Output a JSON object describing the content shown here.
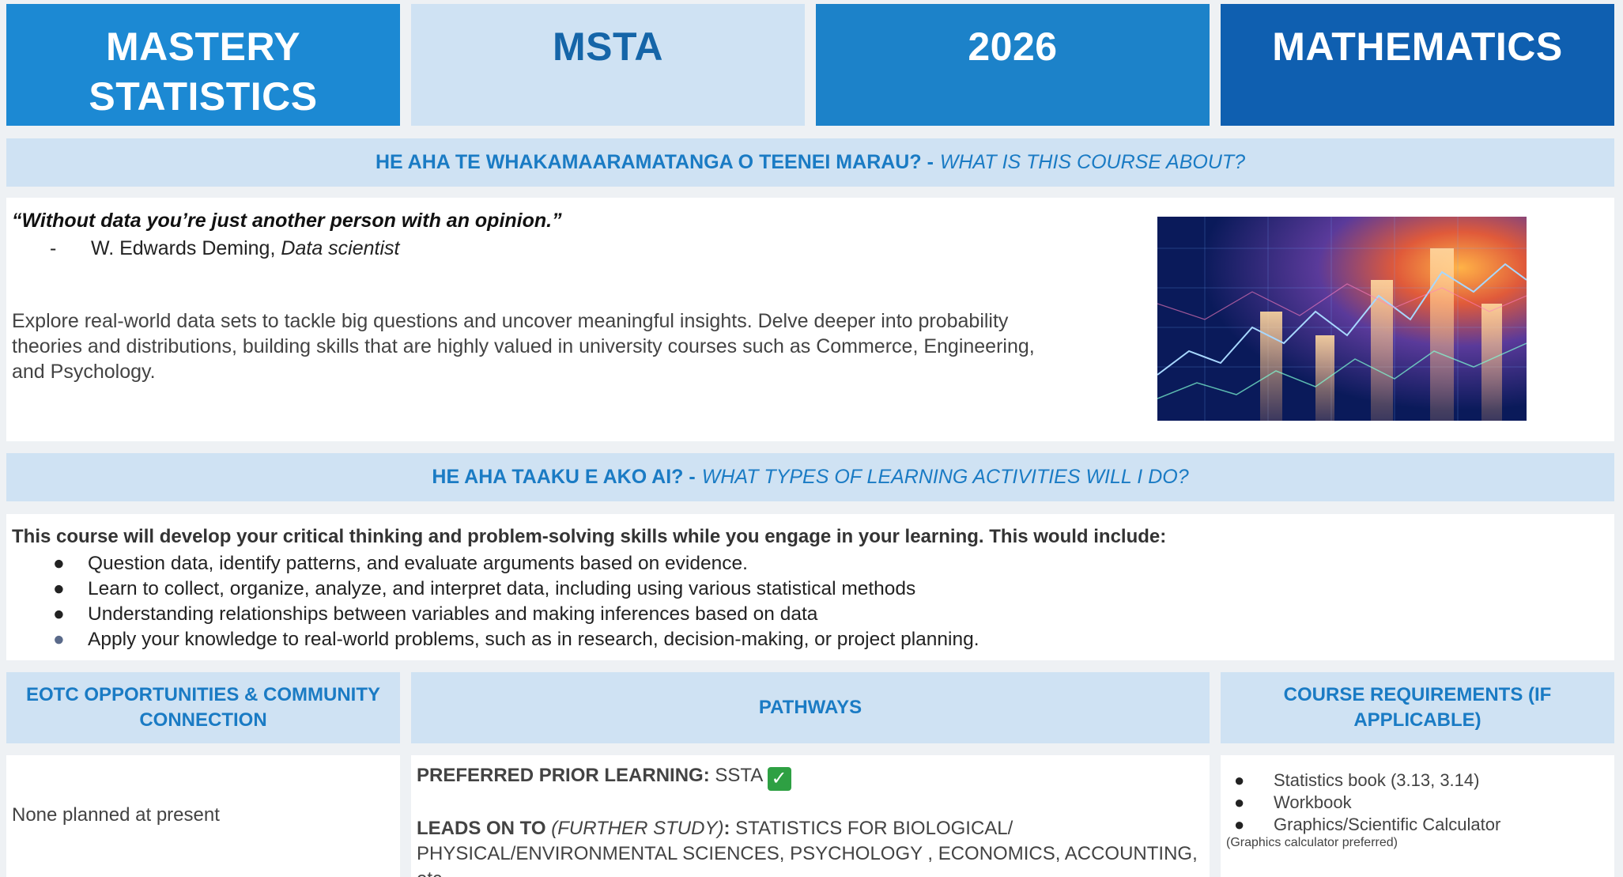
{
  "header": {
    "title": "MASTERY STATISTICS",
    "code": "MSTA",
    "year": "2026",
    "subject": "MATHEMATICS",
    "colors": {
      "title_bg": "#1c89d3",
      "code_bg": "#cfe2f3",
      "year_bg": "#1c82c9",
      "subject_bg": "#0f5fb0",
      "accent": "#1a7bc4"
    }
  },
  "about": {
    "heading_maori": "HE AHA TE WHAKAMAARAMATANGA O TEENEI MARAU? -",
    "heading_english": "WHAT IS THIS COURSE ABOUT?",
    "quote": "“Without data you’re just another person with an opinion.”",
    "attribution_dash": "-",
    "attribution_name": "W. Edwards Deming,",
    "attribution_role": "Data scientist",
    "description": "Explore real-world data sets to tackle big questions and uncover meaningful insights. Delve deeper into probability theories and distributions, building skills that are highly valued in university courses such as Commerce, Engineering, and Psychology.",
    "image_icon": "financial-chart-image"
  },
  "activities": {
    "heading_maori": "HE AHA TAAKU E AKO AI? -",
    "heading_english": "WHAT TYPES OF LEARNING ACTIVITIES WILL I DO?",
    "intro": "This course will develop your critical thinking and problem-solving skills while you engage in your learning. This would include:",
    "items": [
      "Question data, identify patterns, and evaluate arguments based on evidence.",
      "Learn to collect, organize, analyze, and interpret data, including using various statistical methods",
      "Understanding relationships between variables and making inferences based on data",
      "Apply your knowledge to real-world problems, such as in research, decision-making, or project planning."
    ]
  },
  "eotc": {
    "heading": "EOTC OPPORTUNITIES & COMMUNITY CONNECTION",
    "body": "None planned at present"
  },
  "pathways": {
    "heading": "PATHWAYS",
    "prior_label": "PREFERRED PRIOR LEARNING:",
    "prior_value": "SSTA",
    "check_icon": "check-mark-icon",
    "leads_label": "LEADS ON TO",
    "leads_paren": "(FURTHER STUDY)",
    "leads_colon": ":",
    "leads_line1": "STATISTICS FOR BIOLOGICAL/",
    "leads_line2": "PHYSICAL/ENVIRONMENTAL SCIENCES, PSYCHOLOGY , ECONOMICS, ACCOUNTING, etc"
  },
  "requirements": {
    "heading": "COURSE REQUIREMENTS (IF APPLICABLE)",
    "items": [
      "Statistics book (3.13, 3.14)",
      "Workbook",
      "Graphics/Scientific Calculator"
    ],
    "note": "(Graphics calculator preferred)"
  }
}
